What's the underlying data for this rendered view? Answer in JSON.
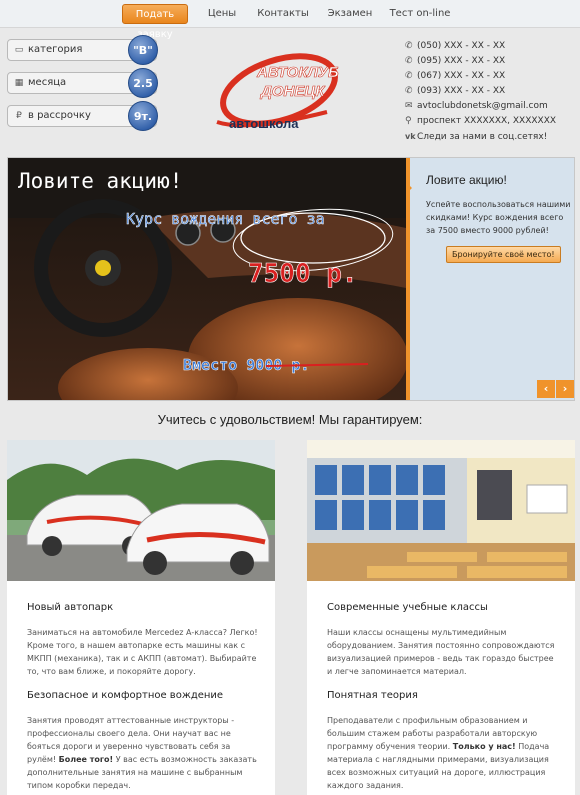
{
  "nav": {
    "items": [
      "Подать заявку",
      "Цены",
      "Контакты",
      "Экзамен",
      "Тест on-line"
    ]
  },
  "pills": [
    {
      "icon": "car-icon",
      "label": "категория",
      "badge": "\"B\""
    },
    {
      "icon": "calendar-icon",
      "label": "месяца",
      "badge": "2.5"
    },
    {
      "icon": "ruble-icon",
      "label": "в рассрочку",
      "badge": "9т."
    }
  ],
  "logo": {
    "line1": "АВТОКЛУБ",
    "line2": "ДОНЕЦК",
    "line3": "автошкола"
  },
  "contacts": [
    {
      "icon": "phone-icon",
      "text": "(050) XXX - XX - XX"
    },
    {
      "icon": "phone-icon",
      "text": "(095) XXX - XX - XX"
    },
    {
      "icon": "phone-icon",
      "text": "(067) XXX - XX - XX"
    },
    {
      "icon": "phone-icon",
      "text": "(093) XXX - XX - XX"
    },
    {
      "icon": "envelope-icon",
      "text": "avtoclubdonetsk@gmail.com"
    },
    {
      "icon": "map-marker-icon",
      "text": "проспект XXXXXXX, XXXXXXX"
    },
    {
      "icon": "vk-icon",
      "text": "Следи за нами в соц.сетях!"
    }
  ],
  "slider": {
    "image_title": "Ловите акцию!",
    "image_line": "Курс вождения всего за",
    "image_price": "7500 р.",
    "image_old": "Вместо 9000 р.",
    "panel_title": "Ловите акцию!",
    "panel_text": "Успейте воспользоваться нашими скидками! Курс вождения всего за 7500 вместо 9000 рублей!",
    "panel_button": "Бронируйте своё место!",
    "prev": "‹",
    "next": "›"
  },
  "section_title": "Учитесь с удовольствием! Мы гарантируем:",
  "cards": [
    {
      "h1": "Новый автопарк",
      "p1": "Заниматься на автомобиле Mercedez A-класса? Легко! Кроме того, в нашем автопарке есть машины как с МКПП (механика), так и с АКПП (автомат). Выбирайте то, что вам ближе, и покоряйте дорогу.",
      "h2": "Безопасное и комфортное вождение",
      "p2": "Занятия проводят аттестованные инструкторы - профессионалы своего дела. Они научат вас не бояться дороги и уверенно чувствовать себя за рулём!",
      "p2b": "Более того!",
      "p2c": " У вас есть возможность заказать дополнительные занятия на машине с выбранным типом коробки передач."
    },
    {
      "h1": "Современные учебные классы",
      "p1": "Наши классы оснащены мультимедийным оборудованием. Занятия постоянно сопровождаются визуализацией примеров - ведь так гораздо быстрее и легче запоминается материал.",
      "h2": "Понятная теория",
      "p2": "Преподаватели с профильным образованием и большим стажем работы разработали авторскую программу обучения теории. ",
      "p2b": "Только у нас!",
      "p2c": " Подача материала с наглядными примерами, визуализация всех возможных ситуаций на дороге, иллюстрация каждого задания."
    }
  ],
  "colors": {
    "accent": "#f0932b",
    "badge": "#2f5ea8",
    "logo_red": "#d9301f",
    "panel_bg": "#d6e2ed"
  }
}
